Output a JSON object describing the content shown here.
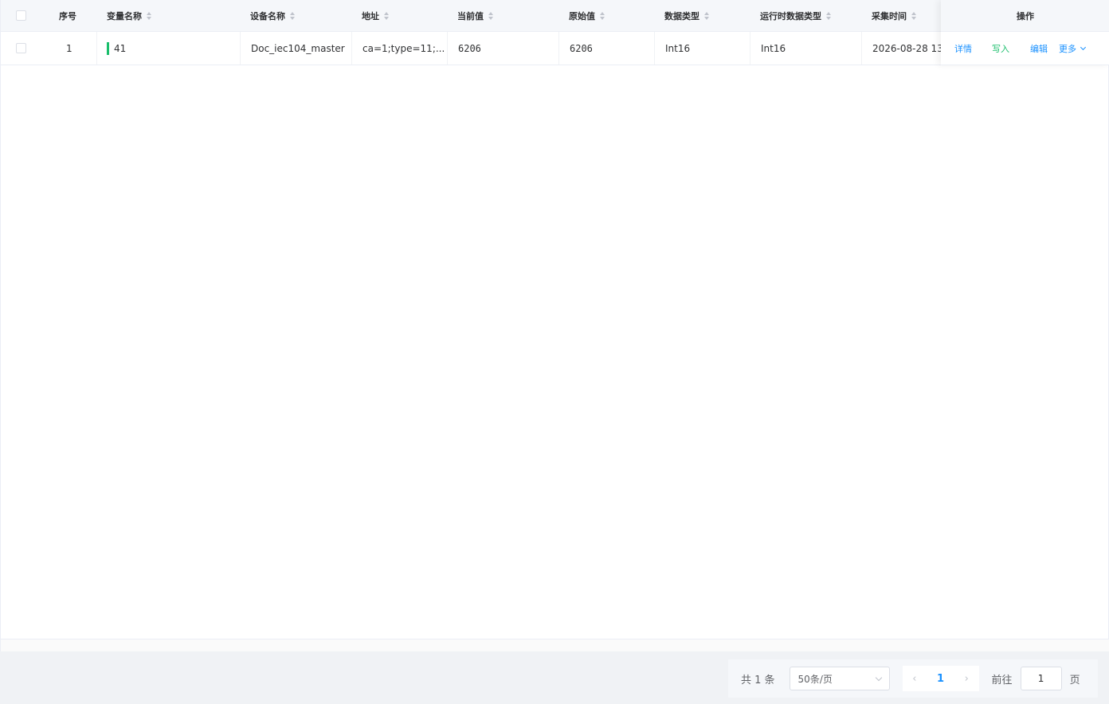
{
  "table": {
    "headers": {
      "index": "序号",
      "var_name": "变量名称",
      "device": "设备名称",
      "address": "地址",
      "current": "当前值",
      "raw": "原始值",
      "dtype": "数据类型",
      "runtime_dtype": "运行时数据类型",
      "collect_time": "采集时间",
      "ops": "操作"
    },
    "rows": [
      {
        "index": "1",
        "var_name": "41",
        "device": "Doc_iec104_master",
        "address": "ca=1;type=11;...",
        "current": "6206",
        "raw": "6206",
        "dtype": "Int16",
        "runtime_dtype": "Int16",
        "collect_time": "2026-08-28 13:",
        "ops": {
          "detail": "详情",
          "write": "写入",
          "edit": "编辑",
          "more": "更多"
        }
      }
    ]
  },
  "pagination": {
    "total": "共 1 条",
    "page_size": "50条/页",
    "prev": "‹",
    "current_page": "1",
    "next": "›",
    "goto_label": "前往",
    "goto_value": "1",
    "page_suffix": "页"
  },
  "colors": {
    "link_blue": "#1890ff",
    "write_green": "#19be6b",
    "status_bar": "#19be6b"
  }
}
